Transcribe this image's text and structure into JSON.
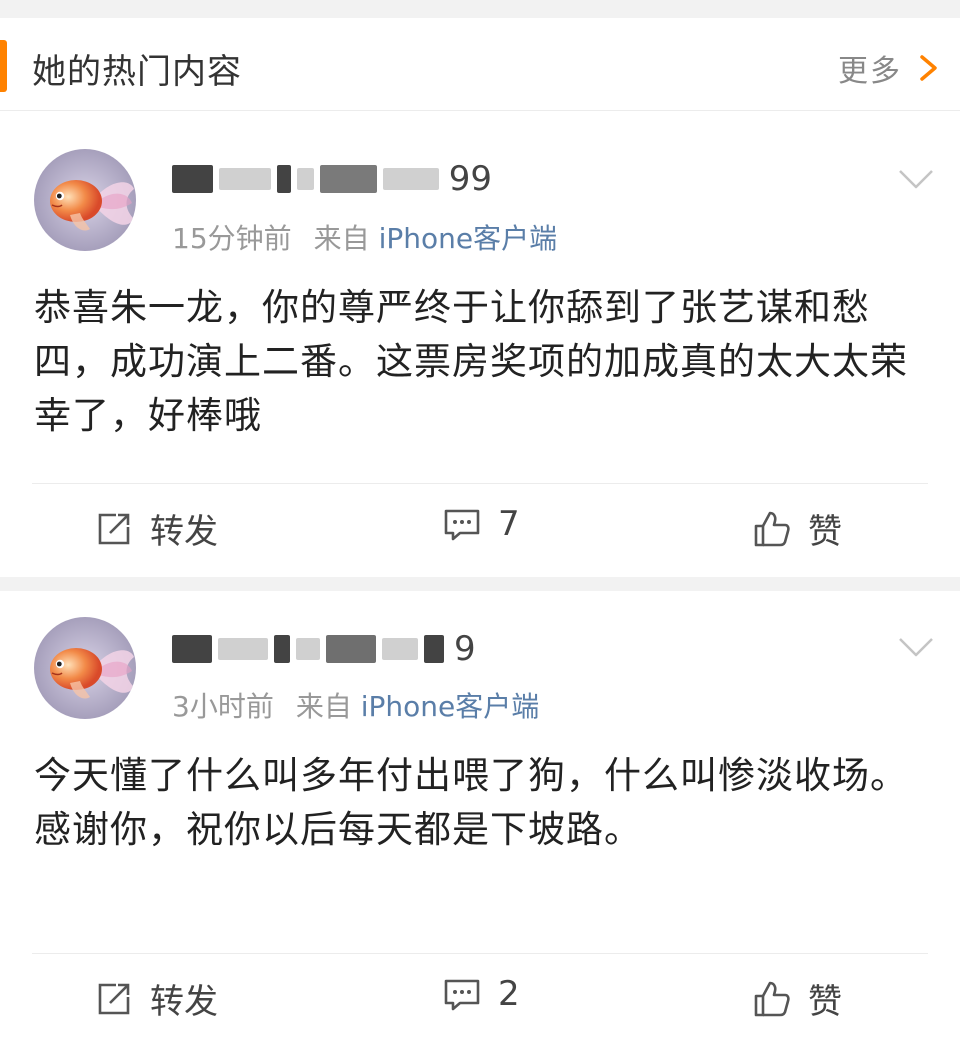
{
  "section": {
    "title": "她的热门内容",
    "more_label": "更多"
  },
  "posts": [
    {
      "username_tail": "99",
      "time": "15分钟前",
      "from_label": "来自",
      "source": "iPhone客户端",
      "text": "恭喜朱一龙，你的尊严终于让你舔到了张艺谋和愁四，成功演上二番。这票房奖项的加成真的太大太荣幸了，好棒哦",
      "repost_label": "转发",
      "comment_count": "7",
      "like_label": "赞"
    },
    {
      "username_tail": "9",
      "time": "3小时前",
      "from_label": "来自",
      "source": "iPhone客户端",
      "text": "今天懂了什么叫多年付出喂了狗，什么叫惨淡收场。感谢你，祝你以后每天都是下坡路。",
      "repost_label": "转发",
      "comment_count": "2",
      "like_label": "赞"
    }
  ],
  "colors": {
    "accent": "#ff8200",
    "link": "#5a7ea8",
    "meta": "#999999"
  },
  "icons": [
    "chevron-right-icon",
    "chevron-down-icon",
    "repost-icon",
    "comment-icon",
    "like-icon",
    "goldfish-avatar"
  ]
}
